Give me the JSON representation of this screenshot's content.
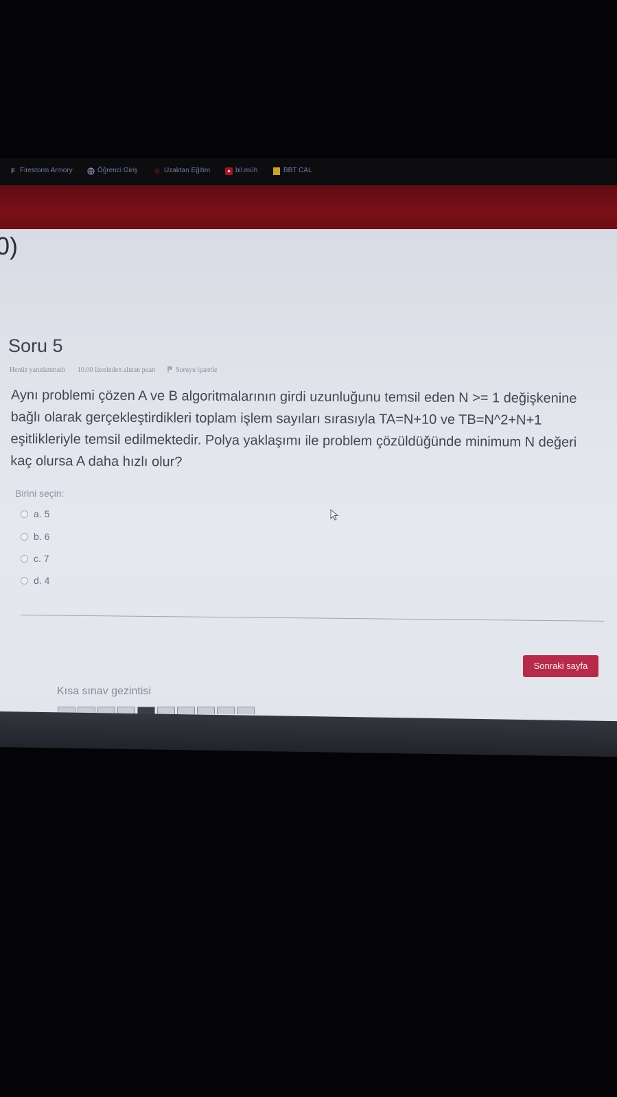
{
  "browser": {
    "tab_strip_text": "",
    "bookmarks": [
      {
        "label": "Firestorm Armory",
        "icon": "firestorm-icon",
        "color": "#6d7ba3"
      },
      {
        "label": "Öğrenci Giriş",
        "icon": "globe-icon",
        "color": "#6d7ba3"
      },
      {
        "label": "Uzaktan Eğitim",
        "icon": "site-icon",
        "color": "#6d7ba3"
      },
      {
        "label": "bil.müh",
        "icon": "red-site-icon",
        "color": "#6d7ba3"
      },
      {
        "label": "BBT CAL",
        "icon": "folder-icon",
        "color": "#6d7ba3"
      }
    ]
  },
  "header": {
    "accent_color": "#7b1018"
  },
  "page": {
    "cut_heading": "0)"
  },
  "question": {
    "title": "Soru 5",
    "status": "Henüz yanıtlanmadı",
    "grade": "10.00 üzerinden alınan puan",
    "flag_label": "Soruyu işaretle",
    "text": "Aynı problemi çözen A ve B algoritmalarının girdi uzunluğunu temsil eden N >= 1 değişkenine bağlı olarak gerçekleştirdikleri toplam işlem sayıları sırasıyla TA=N+10 ve TB=N^2+N+1 eşitlikleriyle temsil edilmektedir. Polya yaklaşımı ile problem çözüldüğünde minimum N değeri kaç olursa A daha hızlı olur?",
    "choose_label": "Birini seçin:",
    "options": [
      {
        "label": "a. 5"
      },
      {
        "label": "b. 6"
      },
      {
        "label": "c. 7"
      },
      {
        "label": "d. 4"
      }
    ]
  },
  "navigation": {
    "next_button": "Sonraki sayfa",
    "next_button_color": "#b62b49",
    "quiz_nav_title": "Kısa sınav gezintisi",
    "question_count": 10,
    "current_question": 5
  }
}
